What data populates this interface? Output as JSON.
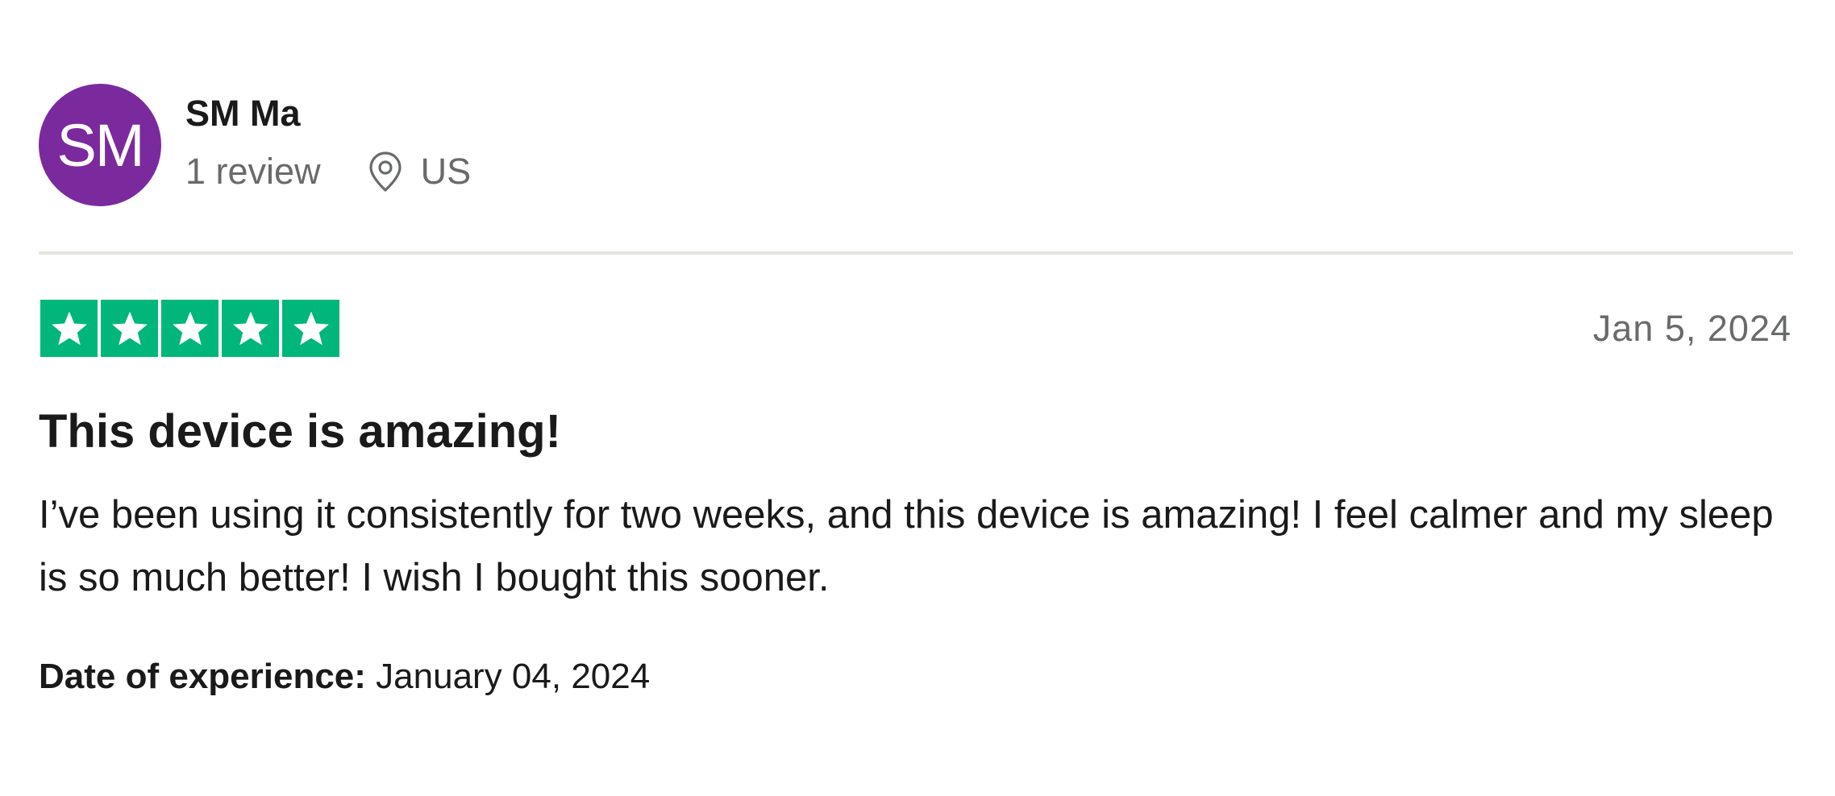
{
  "consumer": {
    "initials": "SM",
    "name": "SM Ma",
    "review_count": "1 review",
    "location": "US",
    "avatar_color": "#7b2a9e"
  },
  "review": {
    "rating": 5,
    "rating_max": 5,
    "star_color": "#00b67a",
    "date": "Jan 5, 2024",
    "title": "This device is amazing!",
    "text": "I’ve been using it consistently for two weeks, and this device is amazing! I feel calmer and my sleep is so much better! I wish I bought this sooner.",
    "experience_label": "Date of experience:",
    "experience_date": "January 04, 2024"
  },
  "icons": {
    "location": "map-pin-icon",
    "star": "star-icon"
  }
}
